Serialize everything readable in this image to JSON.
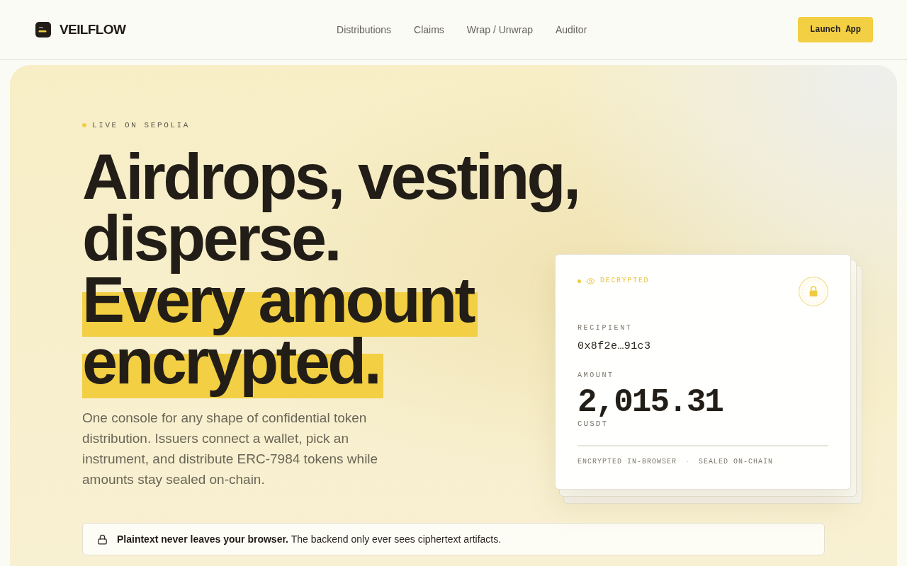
{
  "header": {
    "brand": "VEILFLOW",
    "nav": [
      "Distributions",
      "Claims",
      "Wrap / Unwrap",
      "Auditor"
    ],
    "cta": "Launch App"
  },
  "hero": {
    "eyebrow": "LIVE ON SEPOLIA",
    "headline": [
      {
        "text": "Airdrops, vesting,",
        "highlighted": false
      },
      {
        "text": "disperse.",
        "highlighted": false
      },
      {
        "text": "Every amount",
        "highlighted": true
      },
      {
        "text": "encrypted.",
        "highlighted": true
      }
    ],
    "description": "One console for any shape of confidential token distribution. Issuers connect a wallet, pick an instrument, and distribute ERC-7984 tokens while amounts stay sealed on-chain.",
    "card": {
      "status": "DECRYPTED",
      "recipient_label": "RECIPIENT",
      "recipient": "0x8f2e…91c3",
      "amount_label": "AMOUNT",
      "amount": "2,015.31",
      "token": "CUSDT",
      "footer": {
        "items": [
          "ENCRYPTED IN-BROWSER",
          "SEALED ON-CHAIN"
        ],
        "separator": "·"
      }
    },
    "notice": "**Plaintext never leaves your browser.** The backend only ever sees ciphertext artifacts."
  }
}
